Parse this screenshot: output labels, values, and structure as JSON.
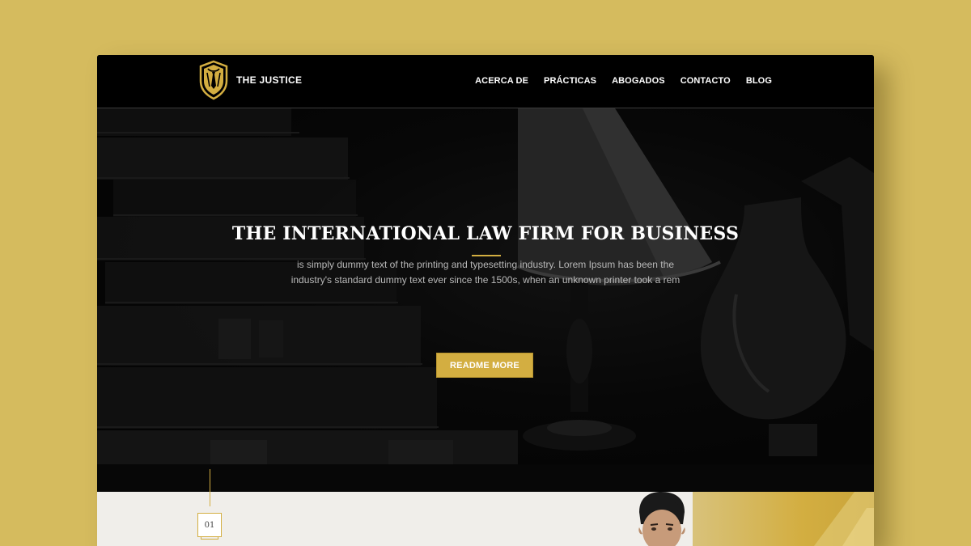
{
  "brand": {
    "name": "THE JUSTICE",
    "icon": "shield-tie-icon",
    "accent": "#d3ae41"
  },
  "nav": {
    "items": [
      {
        "label": "ACERCA DE"
      },
      {
        "label": "PRÁCTICAS"
      },
      {
        "label": "ABOGADOS"
      },
      {
        "label": "CONTACTO"
      },
      {
        "label": "BLOG"
      }
    ]
  },
  "hero": {
    "title": "THE INTERNATIONAL LAW FIRM FOR BUSINESS",
    "subtitle_line1": "is simply dummy text of the printing and typesetting industry. Lorem Ipsum has been the",
    "subtitle_line2": "industry's standard dummy text ever since the 1500s, when an unknown printer took a rem",
    "button_label": "README MORE"
  },
  "section": {
    "step_number": "01"
  },
  "colors": {
    "page_background": "#d5bb5e",
    "header": "#000000",
    "lower_section": "#f0eeea"
  }
}
